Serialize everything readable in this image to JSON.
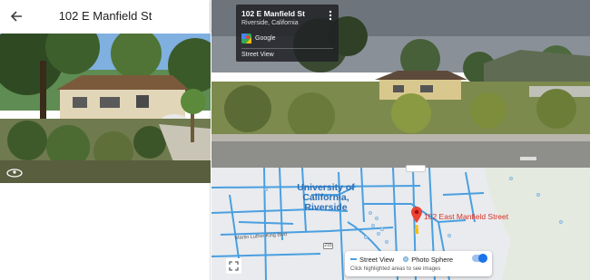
{
  "left_panel": {
    "title": "102 E Manfield St",
    "back_icon": "arrow-back-icon",
    "photo_icon": "360-icon"
  },
  "collapse_tab": {
    "icon": "chevron-left-icon"
  },
  "street_view": {
    "card": {
      "title": "102 E Manfield St",
      "subtitle": "Riverside, California",
      "provider": "Google",
      "label": "Street View",
      "menu_icon": "more-vertical-icon",
      "provider_icon": "google-maps-icon"
    }
  },
  "map": {
    "area_label": "University of California, Riverside",
    "pin_label": "102 East Manfield Street",
    "street_label": "Martin Luther King Blvd",
    "highway_shield": "215",
    "fullscreen_icon": "fullscreen-icon",
    "legend": {
      "street_view": "Street View",
      "photo_sphere": "Photo Sphere",
      "note": "Click highlighted areas to see images",
      "toggle_on": true
    }
  },
  "colors": {
    "coverage_blue": "#4a9fe0",
    "pin_red": "#d93025",
    "card_bg": "#202124",
    "area_label": "#2b6fb5"
  }
}
